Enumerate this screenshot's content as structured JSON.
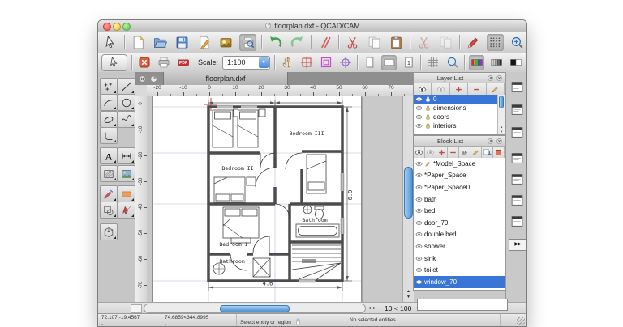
{
  "window": {
    "title": "floorplan.dxf - QCAD/CAM"
  },
  "main_toolbar": {
    "icons": [
      "selection-pointer",
      "new-document",
      "open-document",
      "save-document",
      "svg-export",
      "bitmap-export",
      "print-preview",
      "undo",
      "redo",
      "cut-lines",
      "cut",
      "copy",
      "paste",
      "cut-with-reference",
      "paste-with-reference",
      "property-editor-pen",
      "grid-toggle",
      "zoom-in"
    ],
    "pressed": [
      "print-preview",
      "grid-toggle"
    ],
    "overflow": "»"
  },
  "options_toolbar": {
    "icons_left": [
      "close-drawing",
      "print",
      "pdf-export"
    ],
    "scale_label": "Scale:",
    "scale_value": "1:100",
    "icons_right": [
      "pan-hand",
      "auto-zoom",
      "drawing-borders",
      "origin-crosshair",
      "page-portrait",
      "page-landscape",
      "page-number",
      "grid-lines",
      "zoom-magnifier",
      "color-mode",
      "grayscale-mode",
      "blackwhite-mode"
    ],
    "pressed": [
      "page-landscape",
      "color-mode"
    ],
    "overflow": "»"
  },
  "tool_palette": {
    "tools": [
      "point-tool",
      "line-tool",
      "arc-tool",
      "circle-tool",
      "ellipse-tool",
      "spline-tool",
      "polyline-tool",
      "",
      "text-tool",
      "dimension-tool",
      "hatch-tool",
      "image-tool",
      "modify-tool",
      "solid-fill-tool",
      "boolean-tool",
      "snap-tool",
      "viewport-3d-tool",
      ""
    ]
  },
  "drawing": {
    "tab_label": "floorplan.dxf",
    "h_ruler": [
      "-20",
      "-10",
      "0",
      "10",
      "20",
      "30",
      "40",
      "50",
      "60",
      "70"
    ],
    "v_ruler": [
      "0",
      "-10",
      "-20",
      "-30",
      "-40",
      "-50",
      "-60",
      "-70"
    ],
    "rooms": {
      "bedroom1": "Bedroom I",
      "bedroom2": "Bedroom II",
      "bedroom3": "Bedroom III",
      "bathroom_right": "Bathroom",
      "bathroom_left": "Bathroom"
    },
    "dims": {
      "width": "4.6",
      "height": "6.9"
    },
    "zoom_readout": "10 < 100"
  },
  "layer_list": {
    "title": "Layer List",
    "toolbar": [
      "show-all-layers",
      "hide-all-layers",
      "add-layer",
      "remove-layer",
      "edit-layer"
    ],
    "rows": [
      {
        "name": "0",
        "selected": true
      },
      {
        "name": "dimensions"
      },
      {
        "name": "doors"
      },
      {
        "name": "interiors"
      }
    ]
  },
  "block_list": {
    "title": "Block List",
    "toolbar": [
      "show-all-blocks",
      "hide-all-blocks",
      "add-block",
      "remove-block",
      "rename-block",
      "edit-block",
      "insert-block",
      "delete-block"
    ],
    "rows": [
      {
        "name": "*Model_Space",
        "editing": true
      },
      {
        "name": "*Paper_Space"
      },
      {
        "name": "*Paper_Space0"
      },
      {
        "name": "bath"
      },
      {
        "name": "bed"
      },
      {
        "name": "door_70"
      },
      {
        "name": "double bed"
      },
      {
        "name": "shower"
      },
      {
        "name": "sink"
      },
      {
        "name": "toilet"
      },
      {
        "name": "window_70",
        "selected": true
      }
    ]
  },
  "right_dock": {
    "panels": [
      "property-editor-panel",
      "layer-list-panel",
      "viewports-panel",
      "selection-filter-panel",
      "library-browser-panel",
      "clipboard-panel",
      "command-line-panel"
    ],
    "overflow": "▶▶"
  },
  "status_bar": {
    "abs_position": "72.107,-19.4567",
    "abs_sub": "-",
    "rel_position": "74.6859<344.8995",
    "rel_sub": "-",
    "hint": "Select entity or region",
    "selection_info": "No selected entities."
  },
  "colors": {
    "selection": "#3875d7",
    "scroll_thumb": "#4e92d6",
    "origin_red": "#cc3333"
  }
}
